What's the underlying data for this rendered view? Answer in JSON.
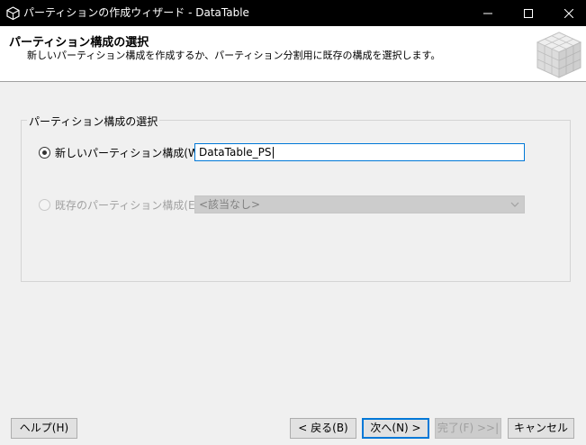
{
  "window": {
    "title": "パーティションの作成ウィザード - DataTable"
  },
  "header": {
    "title": "パーティション構成の選択",
    "description": "新しいパーティション構成を作成するか、パーティション分割用に既存の構成を選択します。"
  },
  "group": {
    "legend": "パーティション構成の選択",
    "new_option": {
      "label": "新しいパーティション構成(W):",
      "checked": true,
      "value": "DataTable_PS"
    },
    "existing_option": {
      "label": "既存のパーティション構成(E):",
      "checked": false,
      "enabled": false,
      "selected": "<該当なし>"
    }
  },
  "buttons": {
    "help": "ヘルプ(H)",
    "back": "< 戻る(B)",
    "next": "次へ(N) >",
    "finish": "完了(F) >>|",
    "cancel": "キャンセル"
  },
  "colors": {
    "accent": "#0078d7",
    "titlebar": "#000000",
    "background": "#f0f0f0"
  },
  "icons": {
    "app": "cube-app-icon",
    "banner": "cube-grid-icon",
    "minimize": "minimize-icon",
    "maximize": "maximize-icon",
    "close": "close-icon",
    "dropdown": "chevron-down-icon"
  }
}
